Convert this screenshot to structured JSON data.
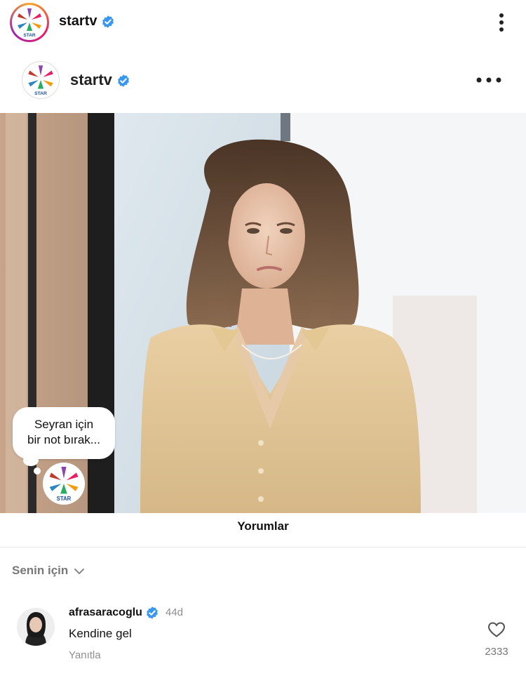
{
  "header": {
    "account_name": "startv",
    "verified": true
  },
  "post": {
    "account_name": "startv",
    "verified": true,
    "logo_caption": "STAR"
  },
  "sticker": {
    "prompt_line1": "Seyran için",
    "prompt_line2": "bir not bırak...",
    "logo_caption": "STAR"
  },
  "comments": {
    "title": "Yorumlar",
    "filter_label": "Senin için",
    "items": [
      {
        "username": "afrasaracoglu",
        "verified": true,
        "time": "44d",
        "text": "Kendine gel",
        "reply_label": "Yanıtla",
        "likes": "2333"
      }
    ]
  },
  "colors": {
    "verified_blue": "#3897f0",
    "muted_text": "#8e8e8e",
    "story_ring": [
      "#f9a825",
      "#e91e63",
      "#9c27b0"
    ]
  }
}
